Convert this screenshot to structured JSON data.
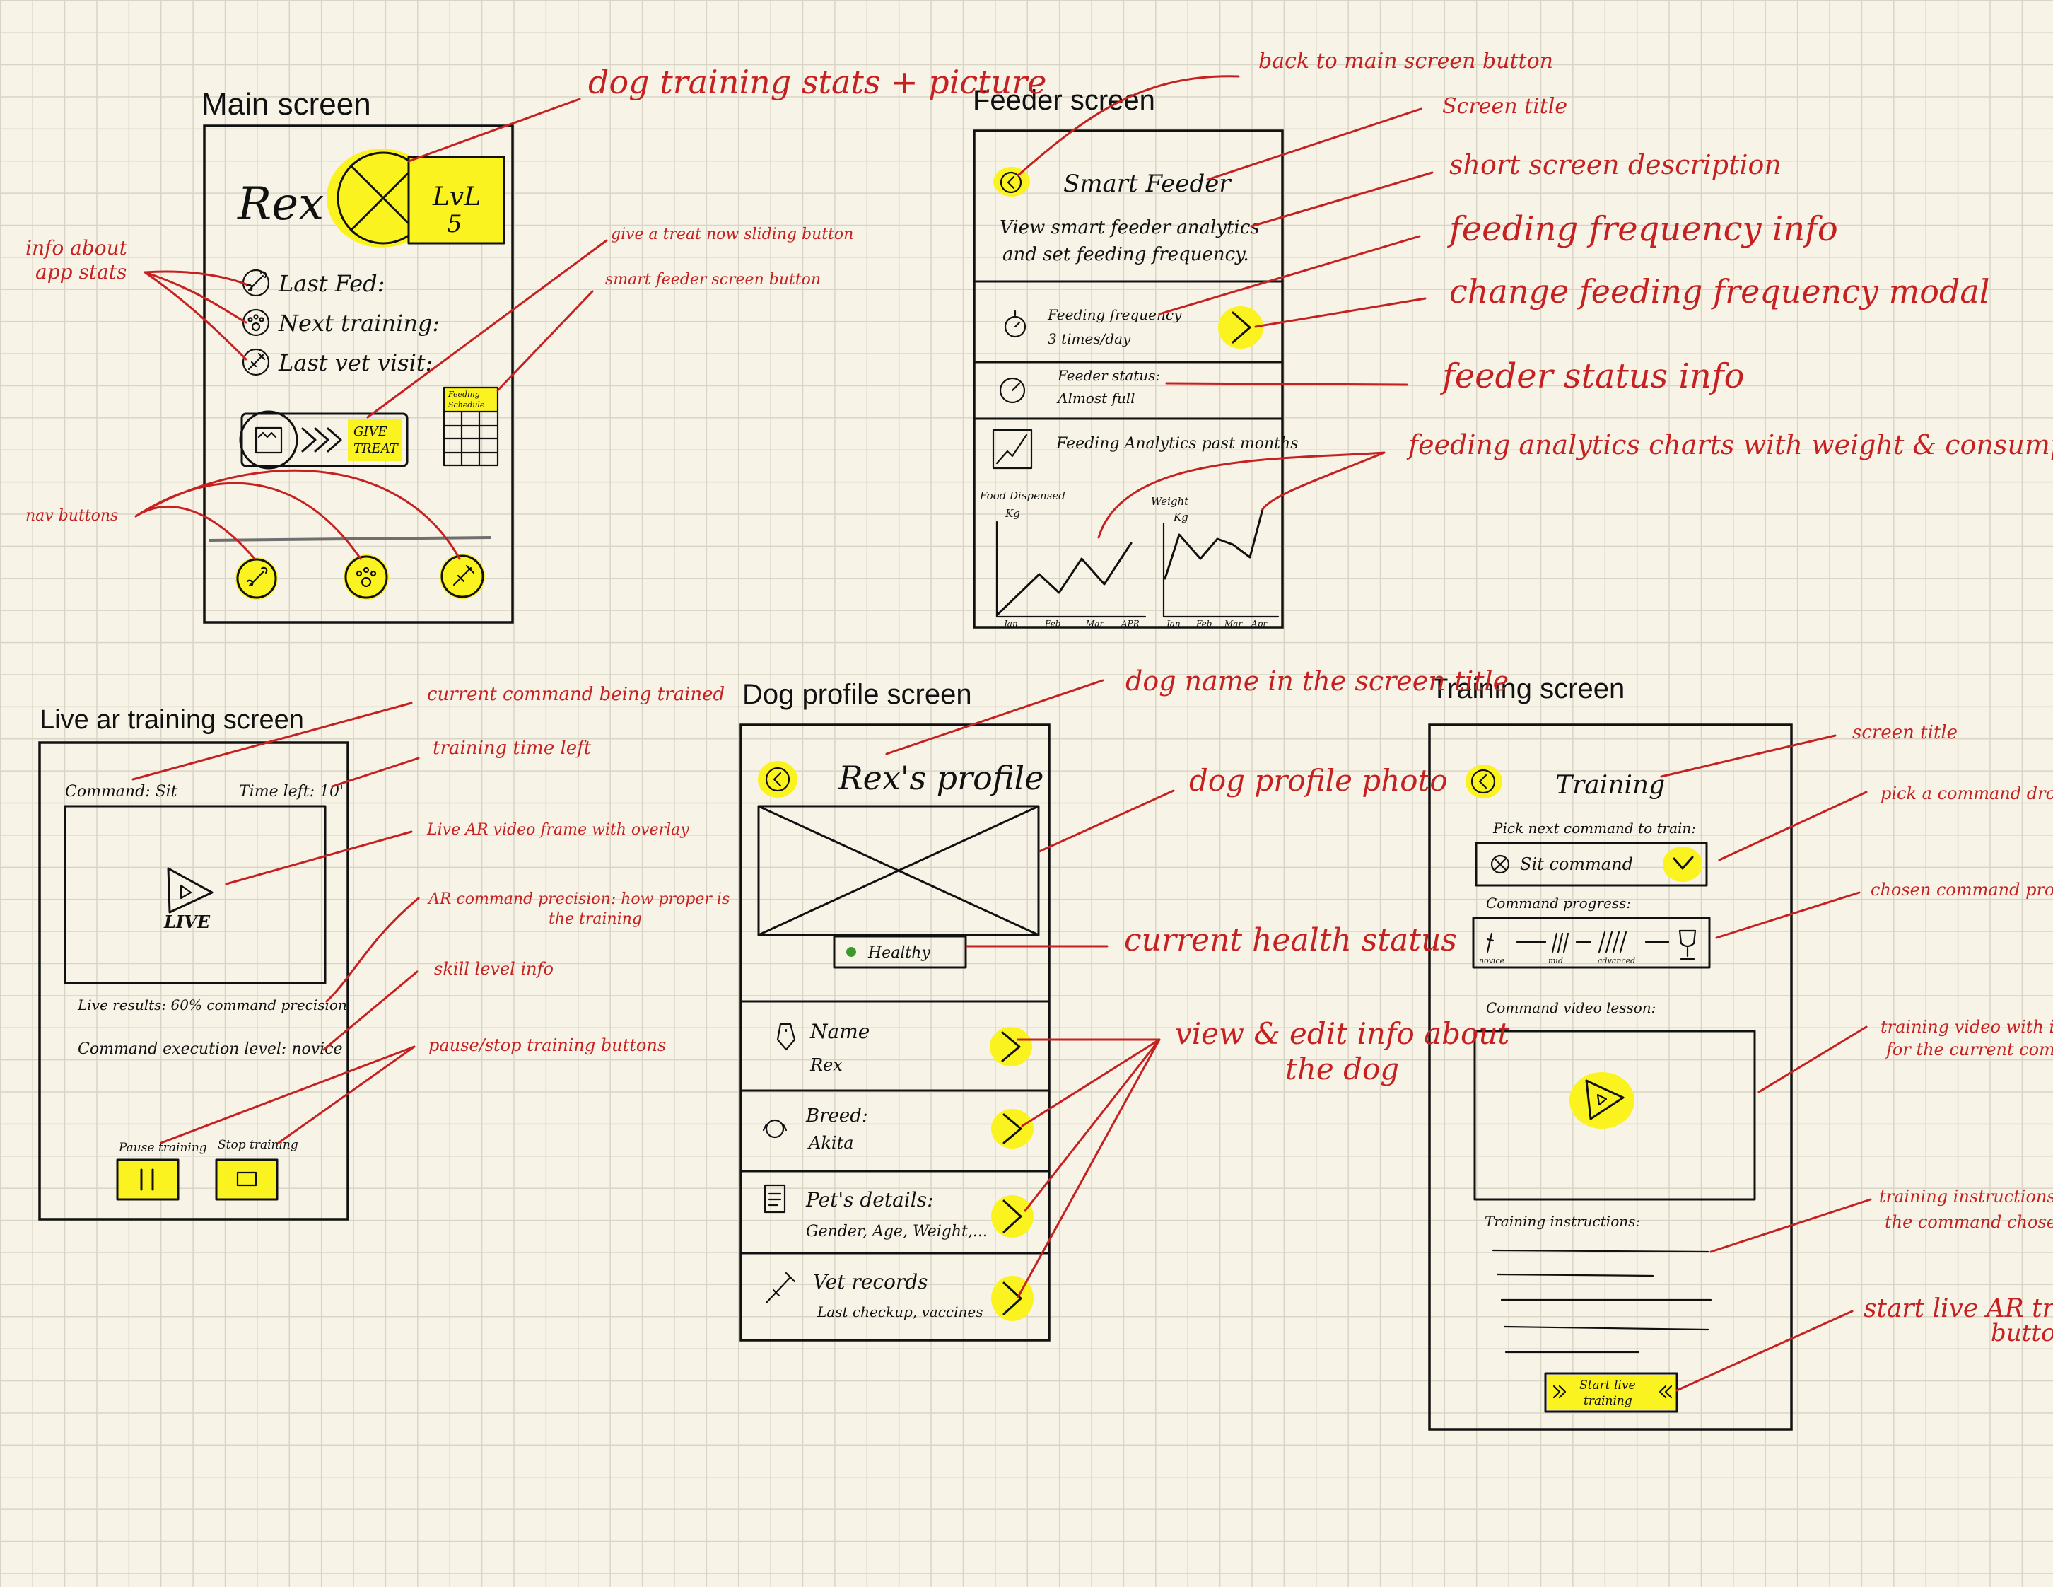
{
  "colors": {
    "paper": "#f7f3e6",
    "grid": "#d9d5c6",
    "ink": "#111111",
    "annotation": "#c62121",
    "highlight": "#fbf31f",
    "healthy_dot": "#3c9a2b"
  },
  "main_screen": {
    "title": "Main screen",
    "dog_name": "Rex",
    "level": {
      "line1": "LvL",
      "line2": "5"
    },
    "stats": [
      {
        "icon": "bone-icon",
        "label": "Last Fed:"
      },
      {
        "icon": "paw-icon",
        "label": "Next training:"
      },
      {
        "icon": "syringe-icon",
        "label": "Last vet visit:"
      }
    ],
    "treat_button": {
      "line1": "GIVE",
      "line2": "TREAT"
    },
    "schedule_button": {
      "line1": "Feeding",
      "line2": "Schedule"
    },
    "nav": [
      {
        "icon": "bone-icon"
      },
      {
        "icon": "paw-icon"
      },
      {
        "icon": "syringe-icon"
      }
    ]
  },
  "feeder_screen": {
    "title": "Feeder screen",
    "heading": "Smart Feeder",
    "description": {
      "line1": "View smart feeder analytics",
      "line2": "and set feeding frequency."
    },
    "frequency": {
      "label": "Feeding frequency",
      "value": "3 times/day"
    },
    "status": {
      "label": "Feeder status:",
      "value": "Almost full"
    },
    "analytics": {
      "label": "Feeding Analytics past months"
    },
    "chart_left": {
      "ylabel": "Food Dispensed",
      "unit": "Kg",
      "ticks": [
        "Jan",
        "Feb",
        "Mar",
        "APR"
      ]
    },
    "chart_right": {
      "ylabel": "Weight",
      "unit": "Kg",
      "ticks": [
        "Jan",
        "Feb",
        "Mar",
        "Apr"
      ]
    }
  },
  "live_screen": {
    "title": "Live ar training screen",
    "command": "Command: Sit",
    "time_left": "Time left: 10'",
    "live_label": "LIVE",
    "results": "Live results: 60% command precision",
    "execution": "Command execution level: novice",
    "pause_label": "Pause training",
    "stop_label": "Stop training"
  },
  "profile_screen": {
    "title": "Dog profile screen",
    "heading": "Rex's profile",
    "health": "Healthy",
    "rows": [
      {
        "icon": "tag-icon",
        "label": "Name",
        "value": "Rex"
      },
      {
        "icon": "dog-icon",
        "label": "Breed:",
        "value": "Akita"
      },
      {
        "icon": "document-icon",
        "label": "Pet's details:",
        "value": "Gender, Age, Weight,..."
      },
      {
        "icon": "syringe-icon",
        "label": "Vet records",
        "value": "Last checkup, vaccines"
      }
    ]
  },
  "training_screen": {
    "title": "Training screen",
    "heading": "Training",
    "pick_label": "Pick next command to train:",
    "command_value": "Sit command",
    "progress_label": "Command progress:",
    "progress_steps": [
      "novice",
      "mid",
      "advanced"
    ],
    "video_label": "Command video lesson:",
    "instructions_label": "Training instructions:",
    "start_button": {
      "line1": "Start live",
      "line2": "training"
    }
  },
  "annotations": {
    "info_stats": {
      "line1": "info about",
      "line2": "app stats"
    },
    "dog_stats": "dog training stats + picture",
    "give_treat": "give a treat now sliding button",
    "feeder_btn": "smart feeder screen button",
    "nav": "nav buttons",
    "back": "back to main screen button",
    "screen_title": "Screen title",
    "short_desc": "short screen description",
    "freq_info": "feeding frequency info",
    "freq_modal": "change feeding frequency modal",
    "status_info": "feeder status info",
    "charts": "feeding analytics charts with weight & consumption",
    "current_cmd": "current command being trained",
    "time_left": "training time left",
    "live_video": "Live AR video frame with overlay",
    "precision": {
      "line1": "AR command precision: how proper is",
      "line2": "the training"
    },
    "skill": "skill level info",
    "pause_stop": "pause/stop training buttons",
    "dog_name": "dog name in the screen title",
    "profile_photo": "dog profile photo",
    "health_status": "current health status",
    "view_edit": {
      "line1": "view & edit info about",
      "line2": "the dog"
    },
    "tr_title": "screen title",
    "pick_dropdown": "pick a command dropdown",
    "chosen_progress": "chosen command progress",
    "video_instr": {
      "line1": "training video with instructions",
      "line2": "for the current command"
    },
    "instr_text": {
      "line1": "training instructions for",
      "line2": "the command chosen"
    },
    "start_ar": {
      "line1": "start live AR training",
      "line2": "button"
    }
  }
}
